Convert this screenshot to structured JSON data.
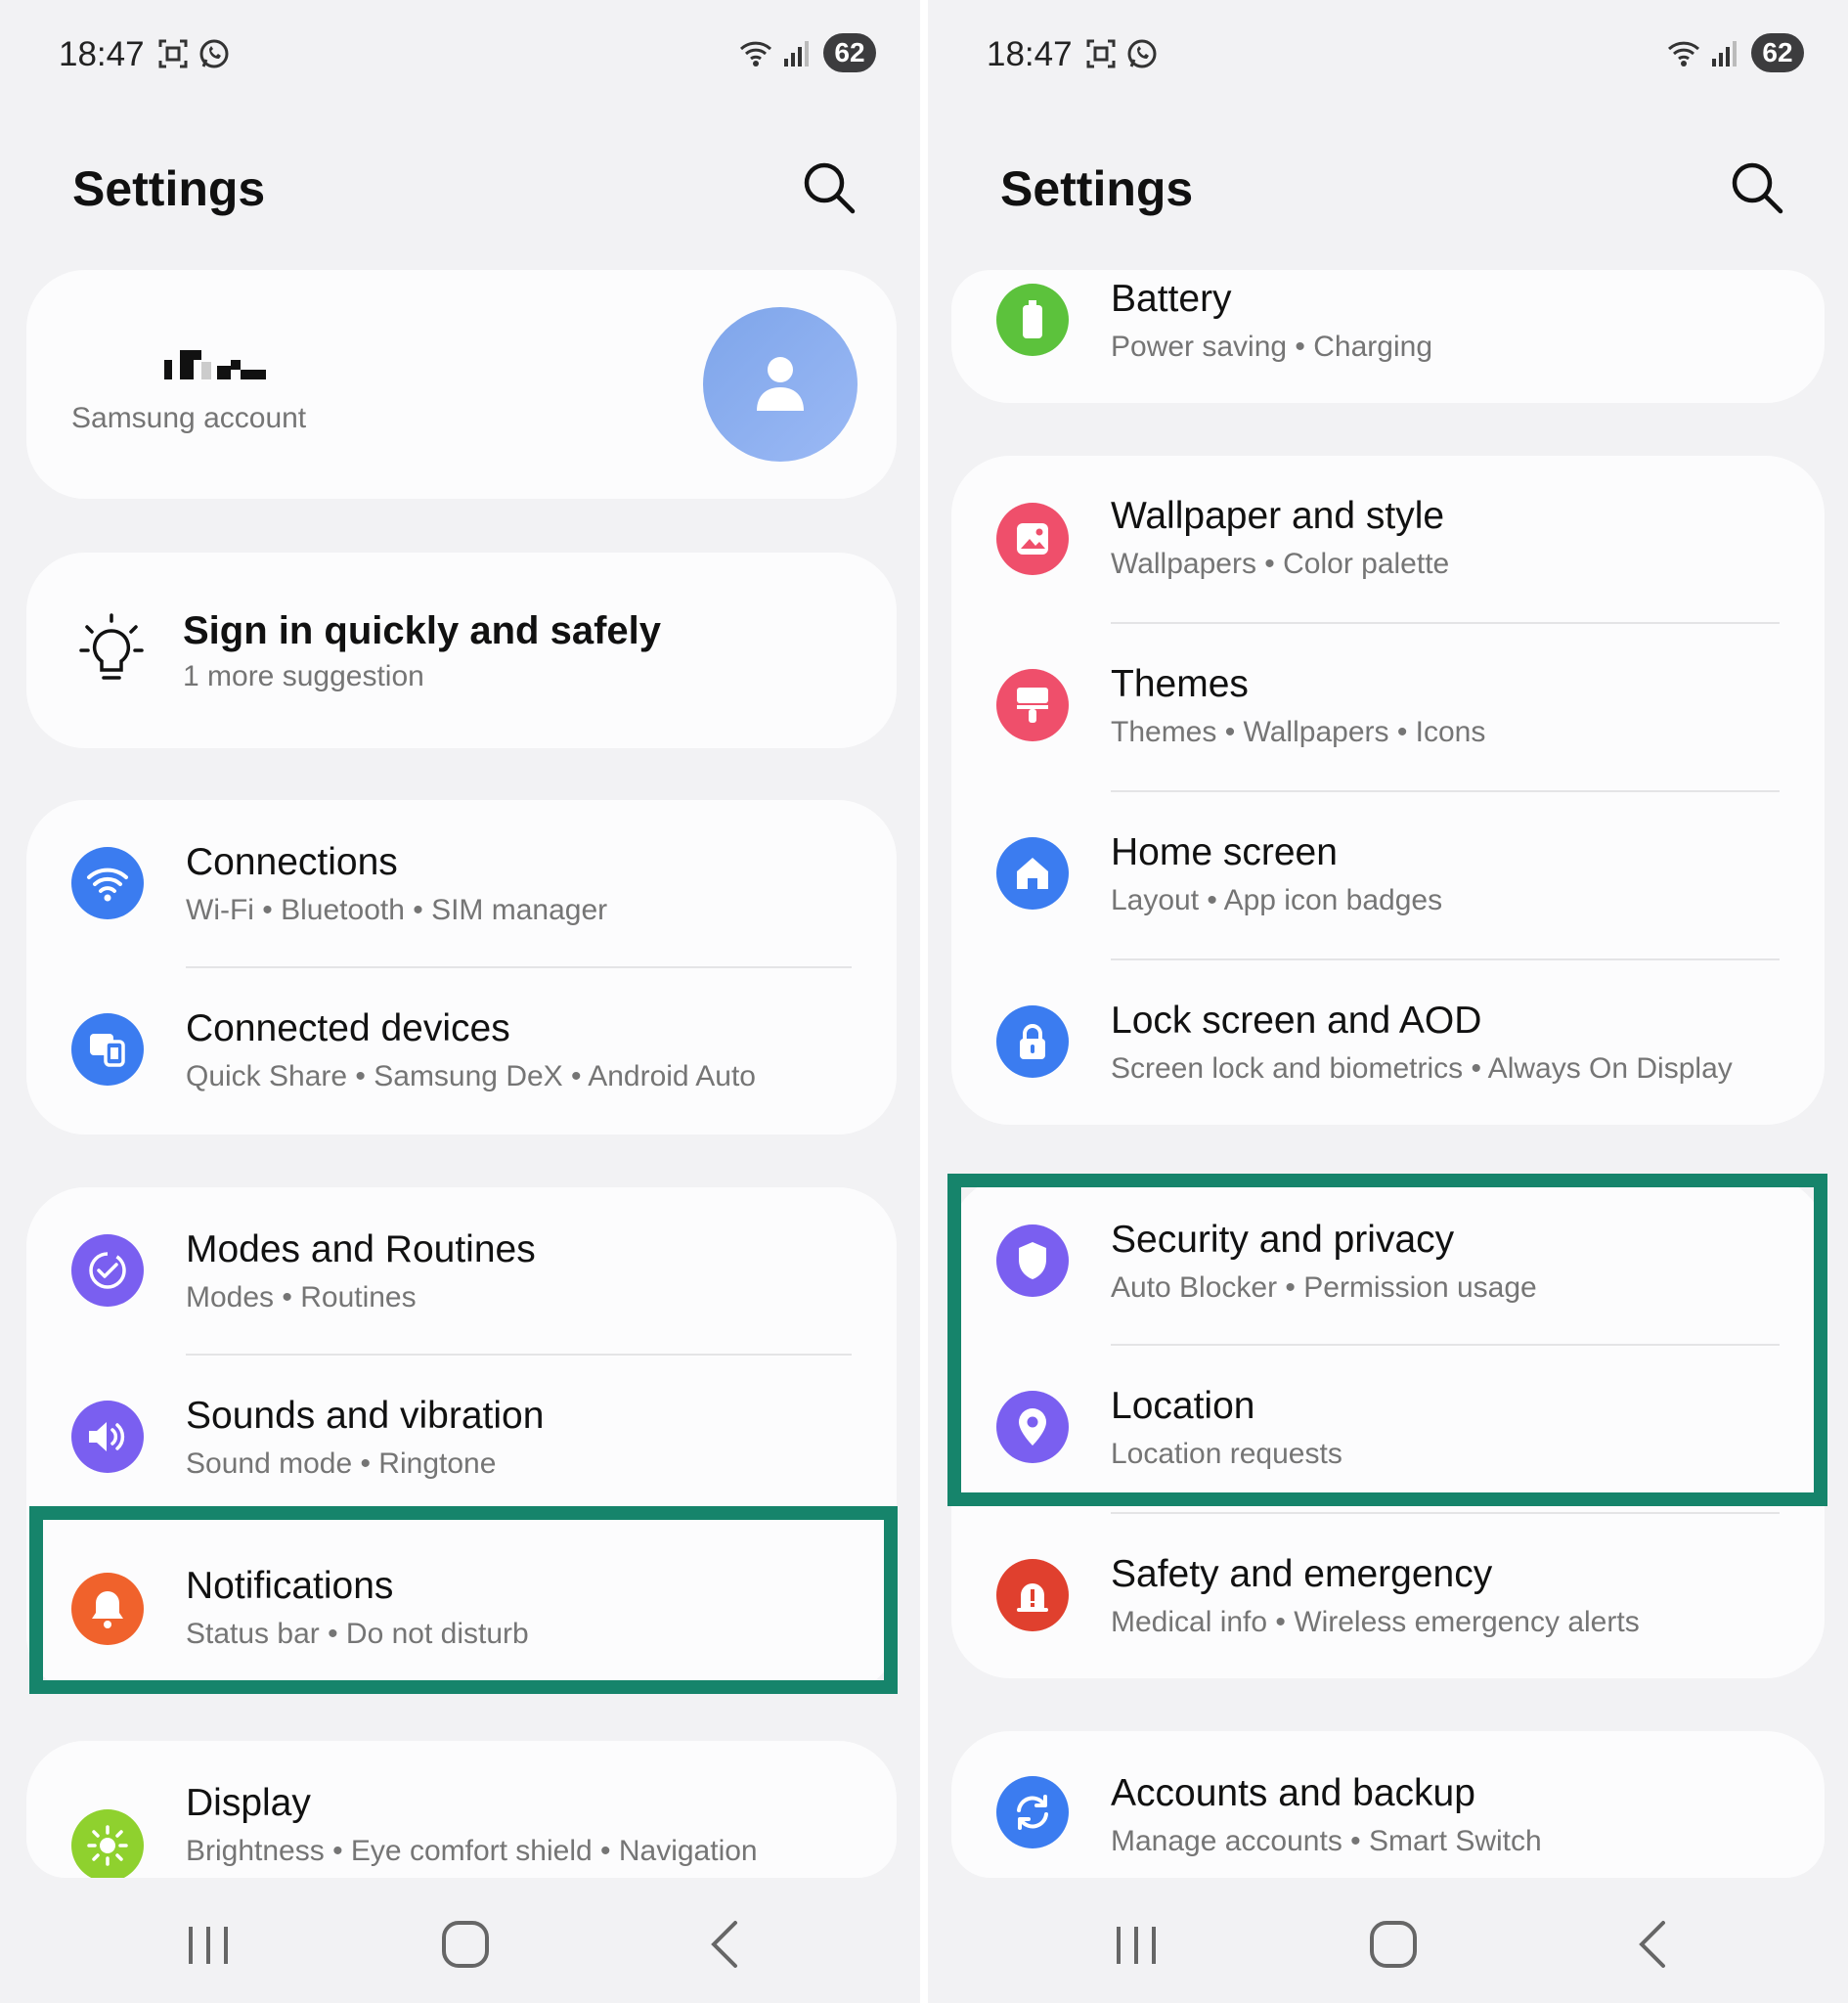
{
  "status_bar": {
    "time": "18:47",
    "battery": "62"
  },
  "header": {
    "title": "Settings"
  },
  "left": {
    "account": {
      "name_hidden": "",
      "label": "Samsung account"
    },
    "suggestion": {
      "title": "Sign in quickly and safely",
      "subtitle": "1 more suggestion"
    },
    "items": [
      {
        "title": "Connections",
        "subtitle": "Wi-Fi  •  Bluetooth  •  SIM manager",
        "color": "#3b7cf0"
      },
      {
        "title": "Connected devices",
        "subtitle": "Quick Share  •  Samsung DeX  •  Android Auto",
        "color": "#3b7cf0"
      },
      {
        "title": "Modes and Routines",
        "subtitle": "Modes  •  Routines",
        "color": "#7a5ff0"
      },
      {
        "title": "Sounds and vibration",
        "subtitle": "Sound mode  •  Ringtone",
        "color": "#7a5ff0"
      },
      {
        "title": "Notifications",
        "subtitle": "Status bar  •  Do not disturb",
        "color": "#f0622c"
      },
      {
        "title": "Display",
        "subtitle": "Brightness  •  Eye comfort shield  •  Navigation",
        "color": "#8fd12e"
      }
    ]
  },
  "right": {
    "items": [
      {
        "title": "Battery",
        "subtitle": "Power saving  •  Charging",
        "color": "#5cc23c"
      },
      {
        "title": "Wallpaper and style",
        "subtitle": "Wallpapers  •  Color palette",
        "color": "#ef4f6b"
      },
      {
        "title": "Themes",
        "subtitle": "Themes  •  Wallpapers  •  Icons",
        "color": "#ef4f6b"
      },
      {
        "title": "Home screen",
        "subtitle": "Layout  •  App icon badges",
        "color": "#3b7cf0"
      },
      {
        "title": "Lock screen and AOD",
        "subtitle": "Screen lock and biometrics  •  Always On Display",
        "color": "#3b7cf0"
      },
      {
        "title": "Security and privacy",
        "subtitle": "Auto Blocker  •  Permission usage",
        "color": "#7a5ff0"
      },
      {
        "title": "Location",
        "subtitle": "Location requests",
        "color": "#7a5ff0"
      },
      {
        "title": "Safety and emergency",
        "subtitle": "Medical info  •  Wireless emergency alerts",
        "color": "#e0402e"
      },
      {
        "title": "Accounts and backup",
        "subtitle": "Manage accounts  •  Smart Switch",
        "color": "#3b7cf0"
      }
    ]
  },
  "highlight_color": "#16846b"
}
